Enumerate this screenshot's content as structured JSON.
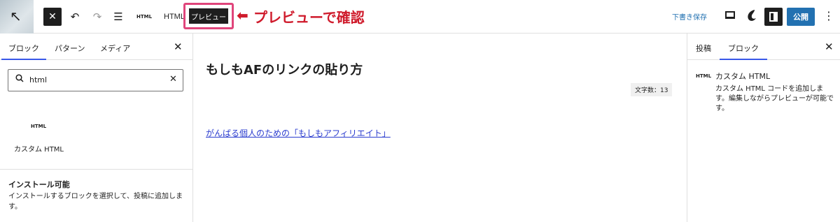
{
  "toolbar": {
    "logo_icon": "↖",
    "close_icon": "✕",
    "undo_icon": "↶",
    "redo_icon": "↷",
    "list_view_icon": "☰",
    "html_mini_icon": "HTML",
    "html_label": "HTML",
    "preview_label": "プレビュー",
    "draft_save_label": "下書き保存",
    "publish_label": "公開",
    "more_icon": "⋮"
  },
  "annotation": {
    "arrow": "⬅",
    "text": "プレビューで確認",
    "color": "#cf1a2b",
    "highlight_color": "#e0457b"
  },
  "left_panel": {
    "tabs": [
      {
        "label": "ブロック",
        "active": true
      },
      {
        "label": "パターン",
        "active": false
      },
      {
        "label": "メディア",
        "active": false
      }
    ],
    "close_icon": "✕",
    "search": {
      "value": "html",
      "clear_icon": "✕"
    },
    "results": [
      {
        "icon": "HTML",
        "label": "カスタム HTML"
      }
    ],
    "install": {
      "title": "インストール可能",
      "description": "インストールするブロックを選択して、投稿に追加します。"
    }
  },
  "editor": {
    "post_title": "もしもAFのリンクの貼り方",
    "word_count": "文字数：13",
    "link_text": "がんばる個人のための「もしもアフィリエイト」"
  },
  "right_panel": {
    "tabs": [
      {
        "label": "投稿",
        "active": false
      },
      {
        "label": "ブロック",
        "active": true
      }
    ],
    "close_icon": "✕",
    "block": {
      "icon": "HTML",
      "name": "カスタム HTML",
      "description": "カスタム HTML コードを追加します。編集しながらプレビューが可能です。"
    }
  },
  "colors": {
    "accent": "#3858e9",
    "publish": "#2271b1",
    "link": "#2b3ccf"
  }
}
